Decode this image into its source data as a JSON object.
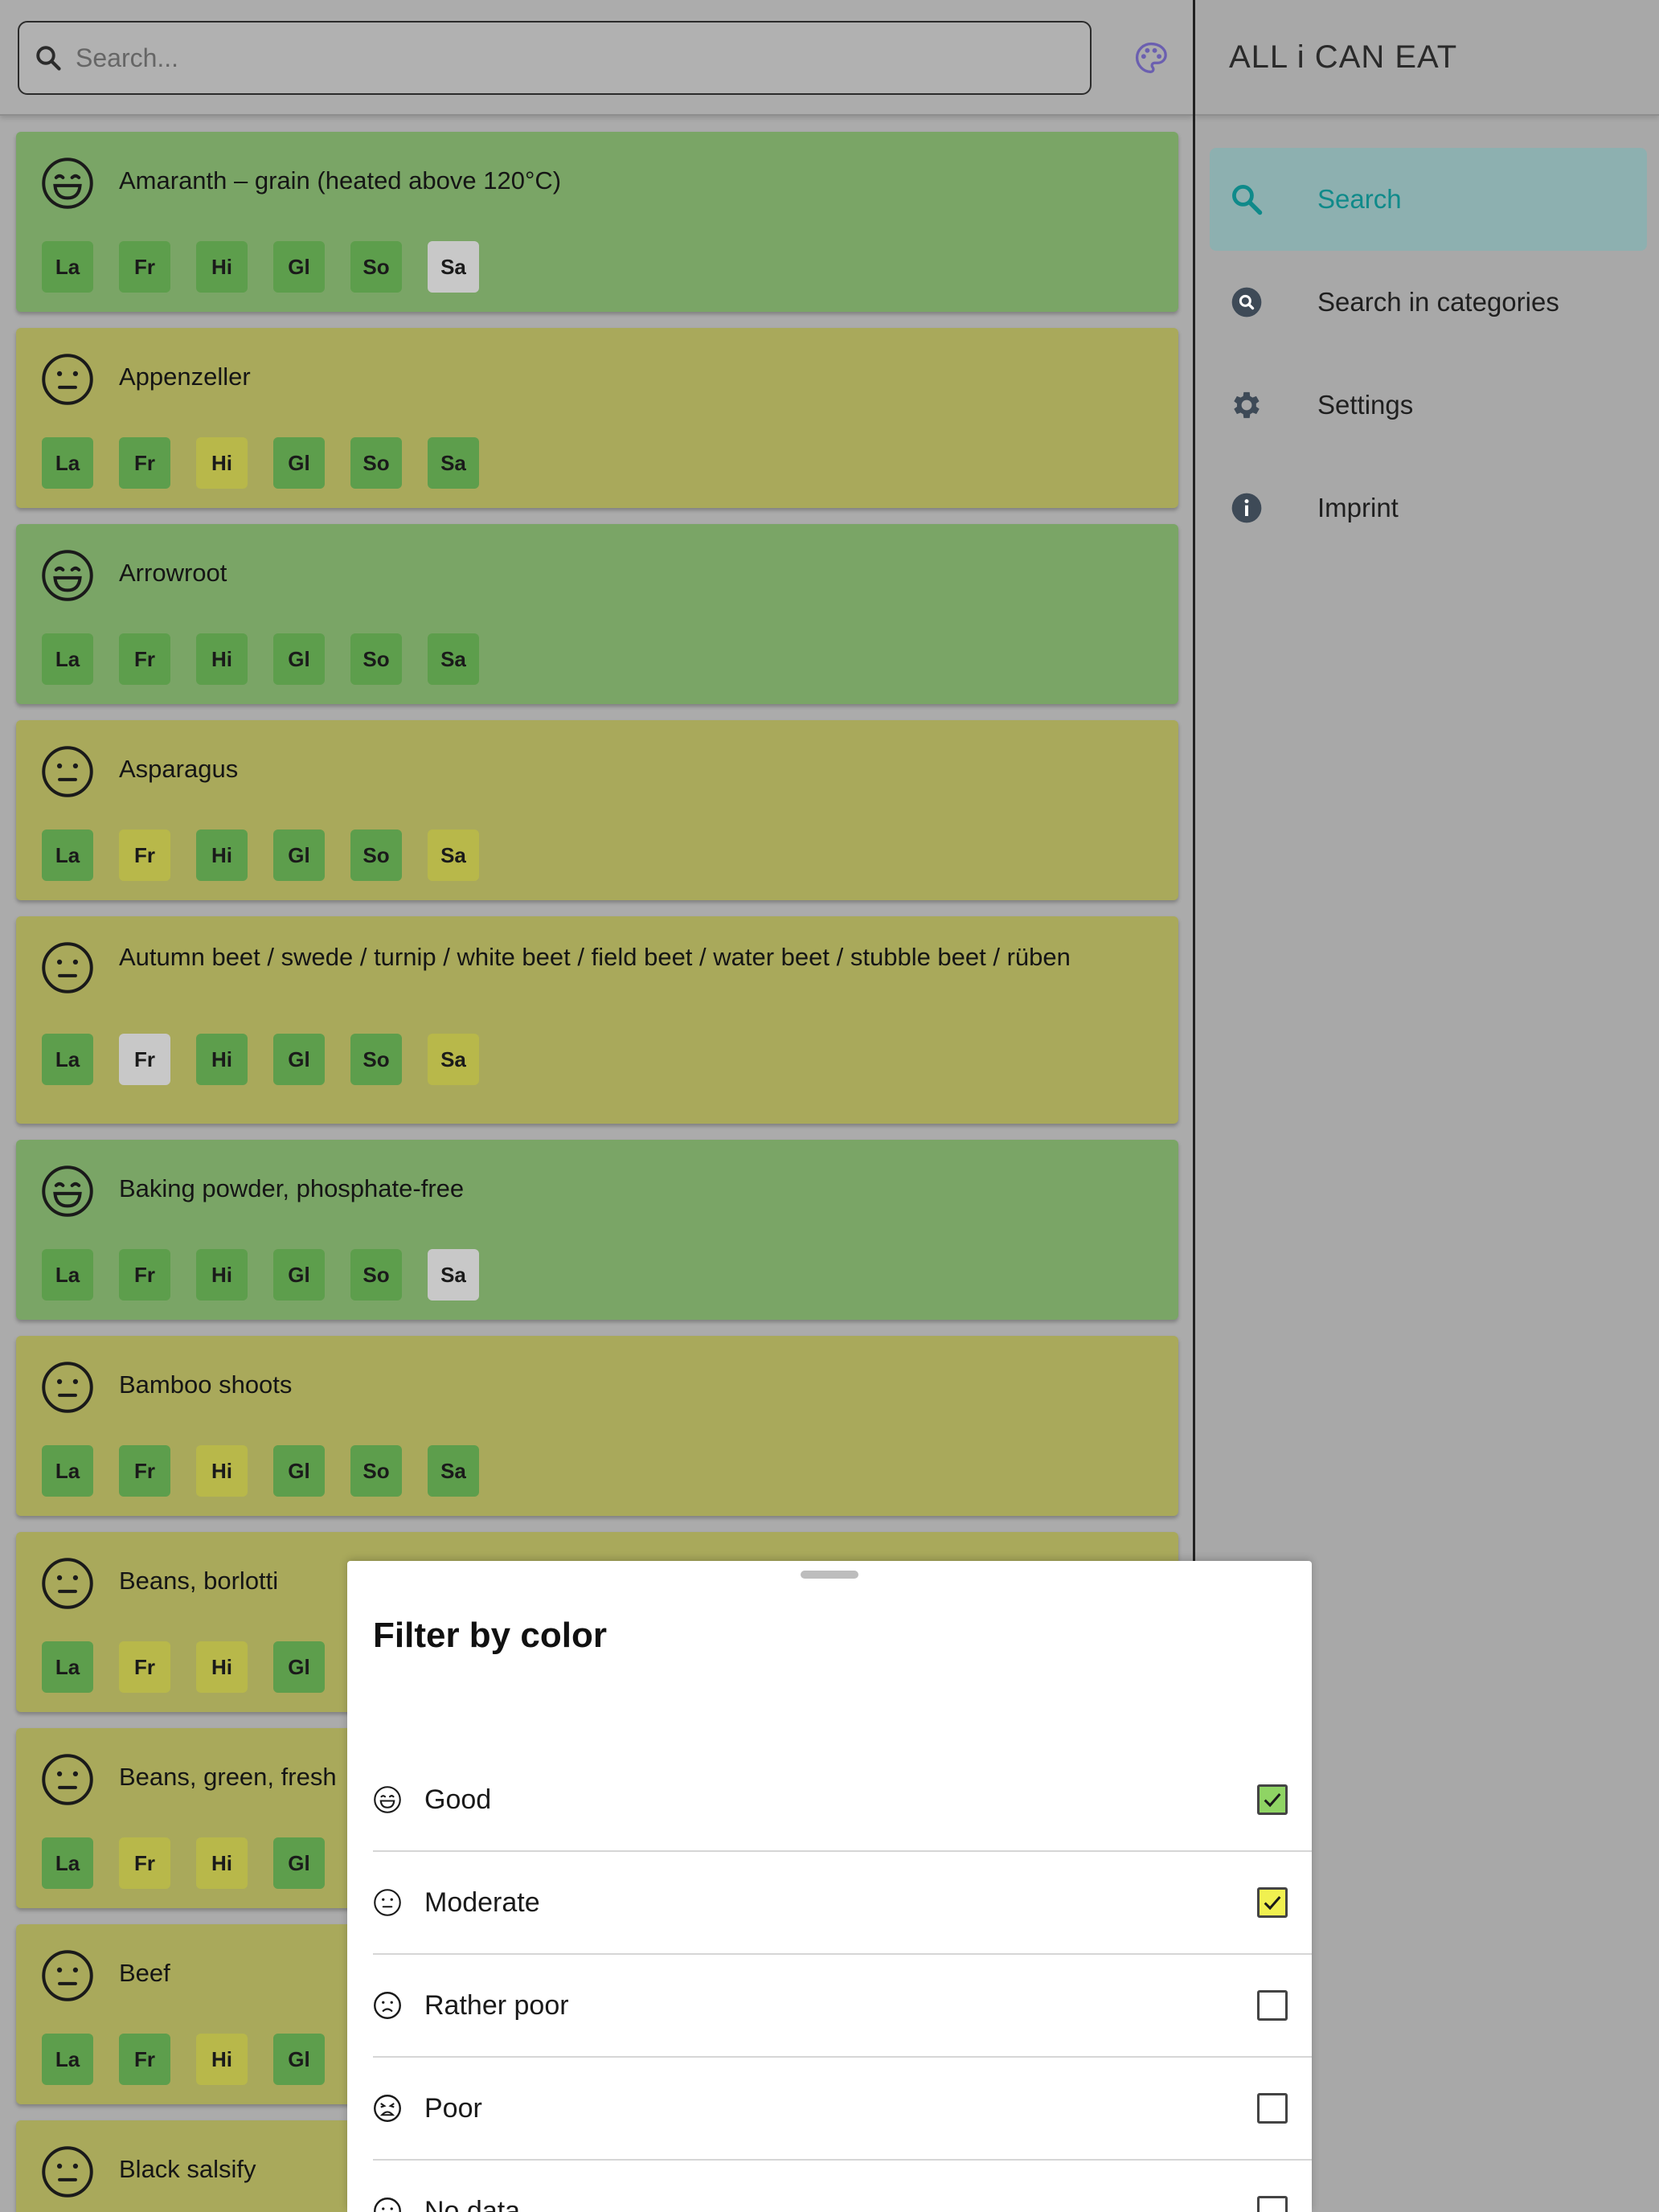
{
  "search": {
    "placeholder": "Search..."
  },
  "nav": {
    "app_title": "ALL i CAN EAT",
    "items": [
      {
        "label": "Search",
        "icon": "search-icon",
        "active": true
      },
      {
        "label": "Search in categories",
        "icon": "category-search-icon",
        "active": false
      },
      {
        "label": "Settings",
        "icon": "gear-icon",
        "active": false
      },
      {
        "label": "Imprint",
        "icon": "info-icon",
        "active": false
      }
    ]
  },
  "foods": [
    {
      "name": "Amaranth – grain (heated above 120°C)",
      "rating": "good",
      "tags": [
        [
          "La",
          "g"
        ],
        [
          "Fr",
          "g"
        ],
        [
          "Hi",
          "g"
        ],
        [
          "Gl",
          "g"
        ],
        [
          "So",
          "g"
        ],
        [
          "Sa",
          "n"
        ]
      ]
    },
    {
      "name": "Appenzeller",
      "rating": "moderate",
      "tags": [
        [
          "La",
          "g"
        ],
        [
          "Fr",
          "g"
        ],
        [
          "Hi",
          "y"
        ],
        [
          "Gl",
          "g"
        ],
        [
          "So",
          "g"
        ],
        [
          "Sa",
          "g"
        ]
      ]
    },
    {
      "name": "Arrowroot",
      "rating": "good",
      "tags": [
        [
          "La",
          "g"
        ],
        [
          "Fr",
          "g"
        ],
        [
          "Hi",
          "g"
        ],
        [
          "Gl",
          "g"
        ],
        [
          "So",
          "g"
        ],
        [
          "Sa",
          "g"
        ]
      ]
    },
    {
      "name": "Asparagus",
      "rating": "moderate",
      "tags": [
        [
          "La",
          "g"
        ],
        [
          "Fr",
          "y"
        ],
        [
          "Hi",
          "g"
        ],
        [
          "Gl",
          "g"
        ],
        [
          "So",
          "g"
        ],
        [
          "Sa",
          "y"
        ]
      ]
    },
    {
      "name": "Autumn beet / swede / turnip / white beet / field beet / water beet / stubble beet / rüben",
      "rating": "moderate",
      "tags": [
        [
          "La",
          "g"
        ],
        [
          "Fr",
          "n"
        ],
        [
          "Hi",
          "g"
        ],
        [
          "Gl",
          "g"
        ],
        [
          "So",
          "g"
        ],
        [
          "Sa",
          "y"
        ]
      ]
    },
    {
      "name": "Baking powder, phosphate-free",
      "rating": "good",
      "tags": [
        [
          "La",
          "g"
        ],
        [
          "Fr",
          "g"
        ],
        [
          "Hi",
          "g"
        ],
        [
          "Gl",
          "g"
        ],
        [
          "So",
          "g"
        ],
        [
          "Sa",
          "n"
        ]
      ]
    },
    {
      "name": "Bamboo shoots",
      "rating": "moderate",
      "tags": [
        [
          "La",
          "g"
        ],
        [
          "Fr",
          "g"
        ],
        [
          "Hi",
          "y"
        ],
        [
          "Gl",
          "g"
        ],
        [
          "So",
          "g"
        ],
        [
          "Sa",
          "g"
        ]
      ]
    },
    {
      "name": "Beans, borlotti",
      "rating": "moderate",
      "tags": [
        [
          "La",
          "g"
        ],
        [
          "Fr",
          "y"
        ],
        [
          "Hi",
          "y"
        ],
        [
          "Gl",
          "g"
        ]
      ]
    },
    {
      "name": "Beans, green, fresh",
      "rating": "moderate",
      "tags": [
        [
          "La",
          "g"
        ],
        [
          "Fr",
          "y"
        ],
        [
          "Hi",
          "y"
        ],
        [
          "Gl",
          "g"
        ]
      ]
    },
    {
      "name": "Beef",
      "rating": "moderate",
      "tags": [
        [
          "La",
          "g"
        ],
        [
          "Fr",
          "g"
        ],
        [
          "Hi",
          "y"
        ],
        [
          "Gl",
          "g"
        ]
      ]
    },
    {
      "name": "Black salsify",
      "rating": "moderate",
      "tags": []
    }
  ],
  "filter": {
    "title": "Filter by color",
    "options": [
      {
        "label": "Good",
        "icon": "laughing-face-icon",
        "checked": true,
        "color": "#8fd464"
      },
      {
        "label": "Moderate",
        "icon": "neutral-face-icon",
        "checked": true,
        "color": "#f0f050"
      },
      {
        "label": "Rather poor",
        "icon": "frown-face-icon",
        "checked": false,
        "color": ""
      },
      {
        "label": "Poor",
        "icon": "tired-face-icon",
        "checked": false,
        "color": ""
      },
      {
        "label": "No data",
        "icon": "blank-face-icon",
        "checked": false,
        "color": ""
      }
    ]
  }
}
